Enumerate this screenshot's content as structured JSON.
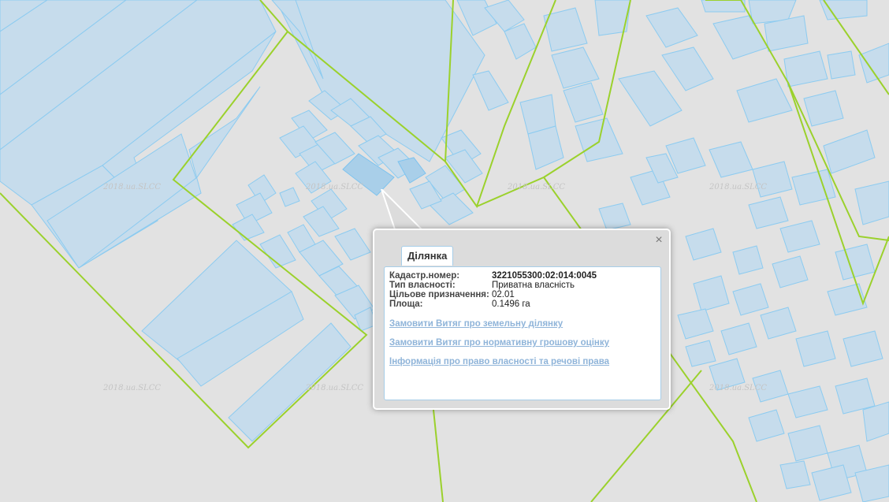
{
  "map": {
    "watermark": "2018.ua.SLCC"
  },
  "popup": {
    "tab_label": "Ділянка",
    "close_label": "×",
    "fields": [
      {
        "key": "Кадастр.номер:",
        "value": "3221055300:02:014:0045"
      },
      {
        "key": "Тип власності:",
        "value": "Приватна власність"
      },
      {
        "key": "Цільове призначення:",
        "value": "02.01"
      },
      {
        "key": "Площа:",
        "value": "0.1496 га"
      }
    ],
    "links": [
      "Замовити Витяг про земельну ділянку",
      "Замовити Витяг про нормативну грошову оцінку",
      "Інформація про право власності та речові права"
    ]
  },
  "colors": {
    "background": "#e2e2e2",
    "parcel_fill": "#c6dcec",
    "parcel_stroke": "#8ccbf0",
    "boundary": "#9bd12c",
    "link": "#8fb4d9"
  }
}
